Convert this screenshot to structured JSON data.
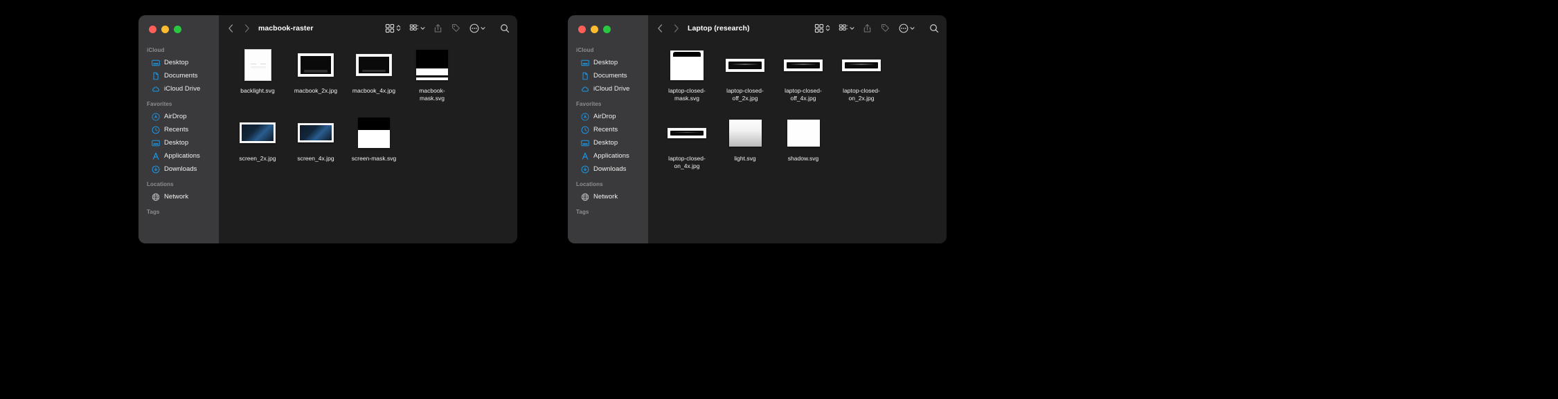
{
  "theme": {
    "desktop_bg": "#000000",
    "sidebar_bg": "#3a3a3c",
    "content_bg": "#1e1e1e",
    "accent": "#1a9bf0",
    "text": "#f2f2f2",
    "muted_text": "#8e8e93",
    "traffic_red": "#ff5f57",
    "traffic_yellow": "#febc2e",
    "traffic_green": "#28c840"
  },
  "windows": [
    {
      "id": "macbook-raster",
      "title": "macbook-raster",
      "traffic_lights": [
        "close",
        "minimize",
        "zoom"
      ],
      "toolbar": {
        "back_icon": "chevron-left-icon",
        "forward_icon": "chevron-right-icon",
        "view_grid_icon": "grid-view-icon",
        "view_sort_icon": "sort-chevrons-icon",
        "group_icon": "group-view-icon",
        "group_chevron_icon": "chevron-down-icon",
        "share_icon": "share-icon",
        "tag_icon": "tag-icon",
        "more_icon": "more-ellipsis-icon",
        "more_chevron_icon": "chevron-down-icon",
        "search_icon": "search-icon"
      },
      "sidebar": [
        {
          "title": "iCloud",
          "items": [
            {
              "label": "Desktop",
              "icon": "desktop-icon"
            },
            {
              "label": "Documents",
              "icon": "document-icon"
            },
            {
              "label": "iCloud Drive",
              "icon": "cloud-icon"
            }
          ]
        },
        {
          "title": "Favorites",
          "items": [
            {
              "label": "AirDrop",
              "icon": "airdrop-icon"
            },
            {
              "label": "Recents",
              "icon": "clock-icon"
            },
            {
              "label": "Desktop",
              "icon": "desktop-icon"
            },
            {
              "label": "Applications",
              "icon": "applications-icon"
            },
            {
              "label": "Downloads",
              "icon": "downloads-icon"
            }
          ]
        },
        {
          "title": "Locations",
          "items": [
            {
              "label": "Network",
              "icon": "network-globe-icon"
            }
          ]
        },
        {
          "title": "Tags",
          "items": []
        }
      ],
      "files": [
        {
          "name": "backlight.svg",
          "thumb": "backlight"
        },
        {
          "name": "macbook_2x.jpg",
          "thumb": "macbook-2x"
        },
        {
          "name": "macbook_4x.jpg",
          "thumb": "macbook-4x"
        },
        {
          "name": "macbook-mask.svg",
          "thumb": "macbook-mask"
        },
        {
          "name": "screen_2x.jpg",
          "thumb": "screen-2x"
        },
        {
          "name": "screen_4x.jpg",
          "thumb": "screen-4x"
        },
        {
          "name": "screen-mask.svg",
          "thumb": "screen-mask"
        }
      ]
    },
    {
      "id": "laptop-research",
      "title": "Laptop (research)",
      "traffic_lights": [
        "close",
        "minimize",
        "zoom"
      ],
      "toolbar": {
        "back_icon": "chevron-left-icon",
        "forward_icon": "chevron-right-icon",
        "view_grid_icon": "grid-view-icon",
        "view_sort_icon": "sort-chevrons-icon",
        "group_icon": "group-view-icon",
        "group_chevron_icon": "chevron-down-icon",
        "share_icon": "share-icon",
        "tag_icon": "tag-icon",
        "more_icon": "more-ellipsis-icon",
        "more_chevron_icon": "chevron-down-icon",
        "search_icon": "search-icon"
      },
      "sidebar": [
        {
          "title": "iCloud",
          "items": [
            {
              "label": "Desktop",
              "icon": "desktop-icon"
            },
            {
              "label": "Documents",
              "icon": "document-icon"
            },
            {
              "label": "iCloud Drive",
              "icon": "cloud-icon"
            }
          ]
        },
        {
          "title": "Favorites",
          "items": [
            {
              "label": "AirDrop",
              "icon": "airdrop-icon"
            },
            {
              "label": "Recents",
              "icon": "clock-icon"
            },
            {
              "label": "Desktop",
              "icon": "desktop-icon"
            },
            {
              "label": "Applications",
              "icon": "applications-icon"
            },
            {
              "label": "Downloads",
              "icon": "downloads-icon"
            }
          ]
        },
        {
          "title": "Locations",
          "items": [
            {
              "label": "Network",
              "icon": "network-globe-icon"
            }
          ]
        },
        {
          "title": "Tags",
          "items": []
        }
      ],
      "files": [
        {
          "name": "laptop-closed-mask.svg",
          "thumb": "laptop-closed-mask"
        },
        {
          "name": "laptop-closed-off_2x.jpg",
          "thumb": "laptop-closed-a"
        },
        {
          "name": "laptop-closed-off_4x.jpg",
          "thumb": "laptop-closed-b"
        },
        {
          "name": "laptop-closed-on_2x.jpg",
          "thumb": "laptop-closed-b"
        },
        {
          "name": "laptop-closed-on_4x.jpg",
          "thumb": "laptop-closed-c"
        },
        {
          "name": "light.svg",
          "thumb": "light"
        },
        {
          "name": "shadow.svg",
          "thumb": "shadow"
        }
      ]
    }
  ]
}
